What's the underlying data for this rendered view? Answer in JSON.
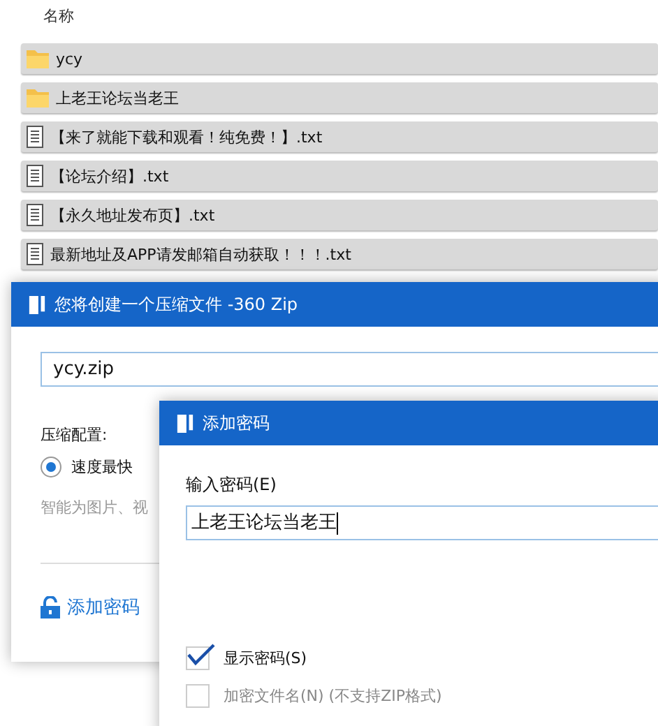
{
  "file_list": {
    "column_header": "名称",
    "items": [
      {
        "kind": "folder",
        "name": "ycy",
        "selected": true
      },
      {
        "kind": "folder",
        "name": "上老王论坛当老王",
        "selected": true
      },
      {
        "kind": "text",
        "name": "【来了就能下载和观看！纯免费！】.txt",
        "selected": true
      },
      {
        "kind": "text",
        "name": "【论坛介绍】.txt",
        "selected": true
      },
      {
        "kind": "text",
        "name": "【永久地址发布页】.txt",
        "selected": true
      },
      {
        "kind": "text",
        "name": "最新地址及APP请发邮箱自动获取！！！.txt",
        "selected": true
      }
    ]
  },
  "zip_window": {
    "title": "您将创建一个压缩文件 -360 Zip",
    "filename_value": "ycy.zip",
    "config_label": "压缩配置:",
    "options": [
      {
        "label": "速度最快",
        "selected": true
      }
    ],
    "description": "智能为图片、视",
    "password_link": "添加密码"
  },
  "password_dialog": {
    "title": "添加密码",
    "password_label": "输入密码(E)",
    "password_value": "上老王论坛当老王",
    "options": [
      {
        "label": "显示密码(S)",
        "checked": true,
        "disabled": false
      },
      {
        "label": "加密文件名(N) (不支持ZIP格式)",
        "checked": false,
        "disabled": true
      }
    ]
  }
}
